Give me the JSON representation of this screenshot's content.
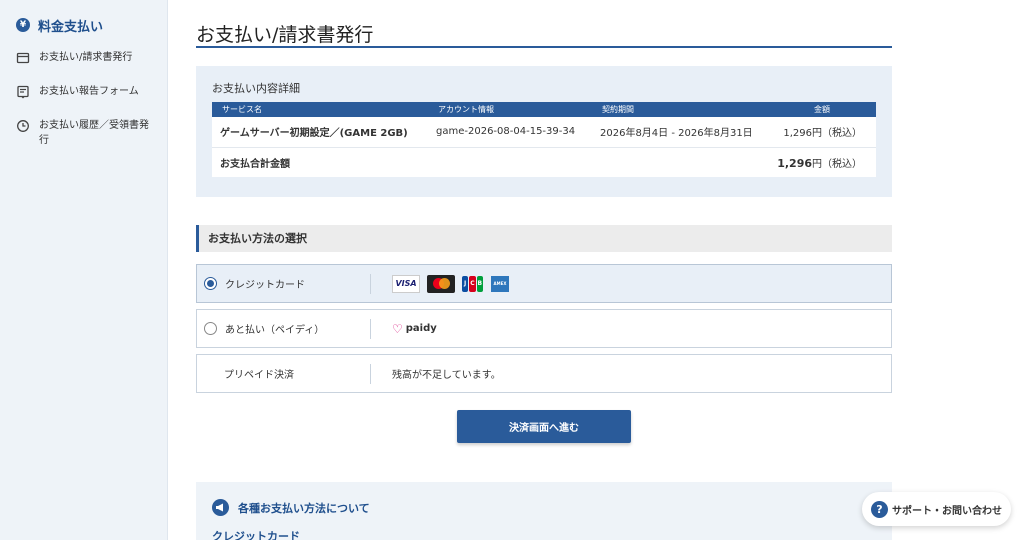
{
  "sidebar": {
    "header": {
      "label": "料金支払い",
      "icon": "yen-circle-icon"
    },
    "items": [
      {
        "label": "お支払い/請求書発行",
        "icon": "card-icon"
      },
      {
        "label": "お支払い報告フォーム",
        "icon": "form-icon"
      },
      {
        "label": "お支払い履歴／受領書発行",
        "icon": "clock-icon"
      }
    ]
  },
  "page": {
    "title": "お支払い/請求書発行"
  },
  "details": {
    "title": "お支払い内容詳細",
    "columns": [
      "サービス名",
      "アカウント情報",
      "契約期間",
      "金額"
    ],
    "rows": [
      {
        "service": "ゲームサーバー初期設定／(GAME 2GB)",
        "account": "game-2026-08-04-15-39-34",
        "period": "2026年8月4日 - 2026年8月31日",
        "amount": "1,296円（税込）"
      }
    ],
    "total": {
      "label": "お支払合計金額",
      "amount": "1,296",
      "unit": "円（税込）"
    }
  },
  "payment": {
    "section_title": "お支払い方法の選択",
    "options": [
      {
        "label": "クレジットカード",
        "selected": true,
        "brands": [
          "VISA",
          "Mastercard",
          "JCB",
          "AMEX"
        ]
      },
      {
        "label": "あと払い（ペイディ）",
        "selected": false,
        "brand": "paidy"
      },
      {
        "label": "プリペイド決済",
        "note": "残高が不足しています。"
      }
    ],
    "proceed_label": "決済画面へ進む"
  },
  "info": {
    "title": "各種お支払い方法について",
    "subtitle": "クレジットカード"
  },
  "support": {
    "label": "サポート・お問い合わせ",
    "icon": "question-icon"
  },
  "colors": {
    "accent": "#2a5b9a",
    "sidebar_bg": "#eef3f8",
    "panel_bg": "#e8eff7"
  }
}
